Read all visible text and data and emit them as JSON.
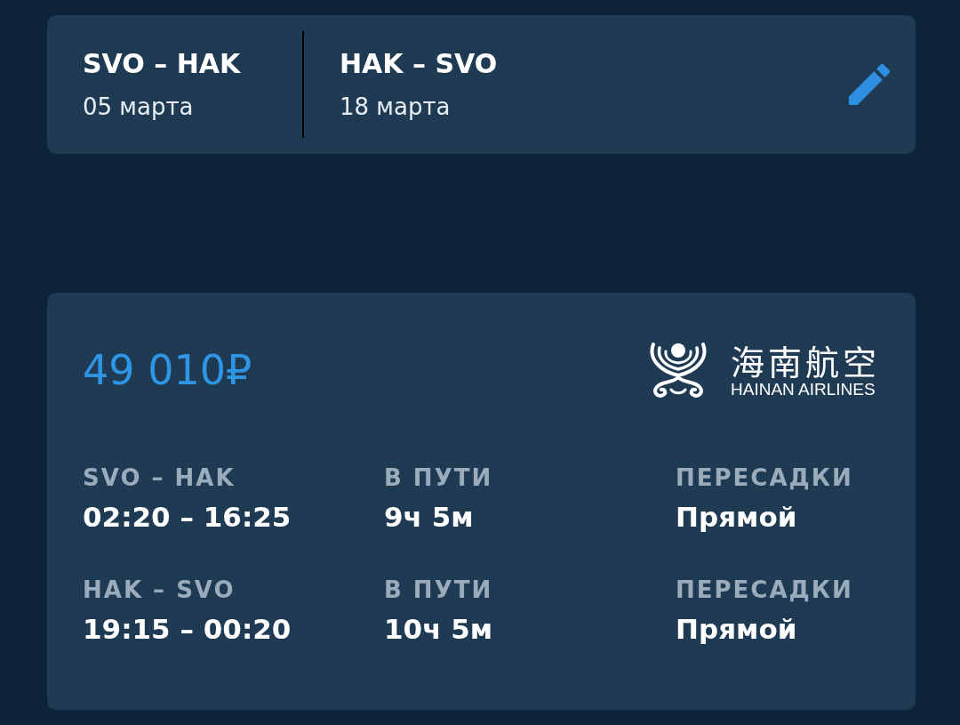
{
  "trip_summary": {
    "legs": [
      {
        "route": "SVO – HAK",
        "date": "05 марта"
      },
      {
        "route": "HAK – SVO",
        "date": "18 марта"
      }
    ]
  },
  "offer": {
    "price": "49 010₽",
    "airline": {
      "name_native": "海南航空",
      "name_latin": "HAINAN AIRLINES"
    },
    "legs": [
      {
        "route": "SVO – HAK",
        "times": "02:20 – 16:25",
        "duration_label": "В ПУТИ",
        "duration": "9ч 5м",
        "stops_label": "ПЕРЕСАДКИ",
        "stops": "Прямой"
      },
      {
        "route": "HAK – SVO",
        "times": "19:15 – 00:20",
        "duration_label": "В ПУТИ",
        "duration": "10ч 5м",
        "stops_label": "ПЕРЕСАДКИ",
        "stops": "Прямой"
      }
    ]
  }
}
